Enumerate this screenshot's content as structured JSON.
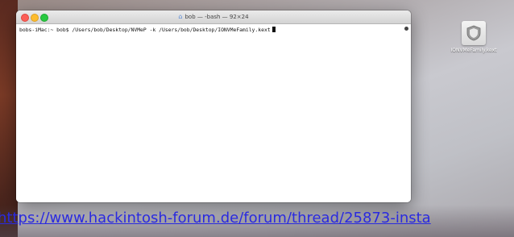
{
  "terminal": {
    "title": "bob — -bash — 92×24",
    "home_icon": "house-icon",
    "prompt_line": "bobs-iMac:~ bob$ /Users/bob/Desktop/NVMeP -k /Users/bob/Desktop/IONVMeFamily.kext"
  },
  "desktop": {
    "file_name": "IONVMeFamily.kext",
    "file_icon": "kext-bundle-icon"
  },
  "overlay": {
    "url": "https://www.hackintosh-forum.de/forum/thread/25873-insta"
  },
  "colors": {
    "close": "#fc5f57",
    "minimize": "#fdbc2e",
    "maximize": "#28c940",
    "link": "#2a2adf"
  }
}
